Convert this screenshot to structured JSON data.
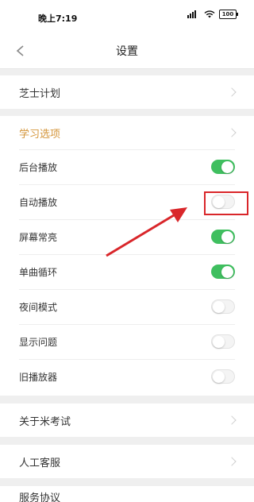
{
  "status_bar": {
    "time": "晚上7:19",
    "battery": "100"
  },
  "nav": {
    "title": "设置"
  },
  "sections": {
    "zhishi": "芝士计划",
    "study_header": "学习选项",
    "about": "关于米考试",
    "service": "人工客服",
    "agreement": "服务协议"
  },
  "toggles": [
    {
      "label": "后台播放",
      "on": true
    },
    {
      "label": "自动播放",
      "on": false
    },
    {
      "label": "屏幕常亮",
      "on": true
    },
    {
      "label": "单曲循环",
      "on": true
    },
    {
      "label": "夜间模式",
      "on": false
    },
    {
      "label": "显示问题",
      "on": false
    },
    {
      "label": "旧播放器",
      "on": false
    }
  ],
  "colors": {
    "accent_orange": "#d4953a",
    "toggle_on": "#3fbf5f",
    "highlight_red": "#d9262a"
  }
}
